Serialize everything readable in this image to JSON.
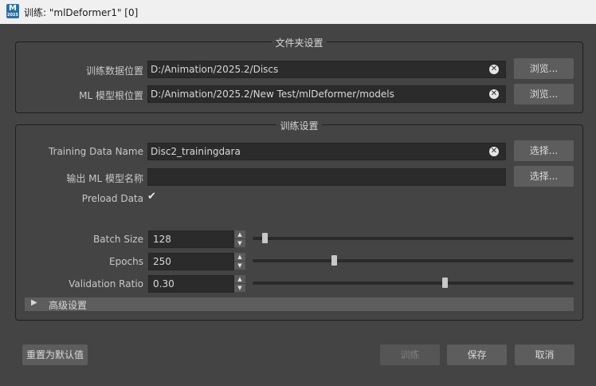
{
  "window": {
    "title": "训练: \"mlDeformer1\" [0]",
    "icon_letter": "M",
    "icon_sub": "2025"
  },
  "folder_settings": {
    "title": "文件夹设置",
    "training_data_location": {
      "label": "训练数据位置",
      "value": "D:/Animation/2025.2/Discs",
      "browse": "浏览..."
    },
    "ml_model_root": {
      "label": "ML 模型根位置",
      "value": "D:/Animation/2025.2/New Test/mlDeformer/models",
      "browse": "浏览..."
    }
  },
  "training_settings": {
    "title": "训练设置",
    "training_data_name": {
      "label": "Training Data Name",
      "value": "Disc2_trainingdara",
      "select": "选择..."
    },
    "output_model_name": {
      "label": "输出 ML 模型名称",
      "value": "",
      "select": "选择..."
    },
    "preload_data": {
      "label": "Preload Data",
      "checked": true
    },
    "batch_size": {
      "label": "Batch Size",
      "value": "128",
      "slider_fraction": 0.03
    },
    "epochs": {
      "label": "Epochs",
      "value": "250",
      "slider_fraction": 0.25
    },
    "validation_ratio": {
      "label": "Validation Ratio",
      "value": "0.30",
      "slider_fraction": 0.6
    },
    "advanced": {
      "label": "高级设置",
      "expanded": false
    }
  },
  "footer": {
    "reset": "重置为默认值",
    "train": "训练",
    "save": "保存",
    "cancel": "取消"
  },
  "icons": {
    "clear": "clear-icon",
    "checkmark": "checkmark-icon",
    "expand": "chevron-right-icon"
  }
}
